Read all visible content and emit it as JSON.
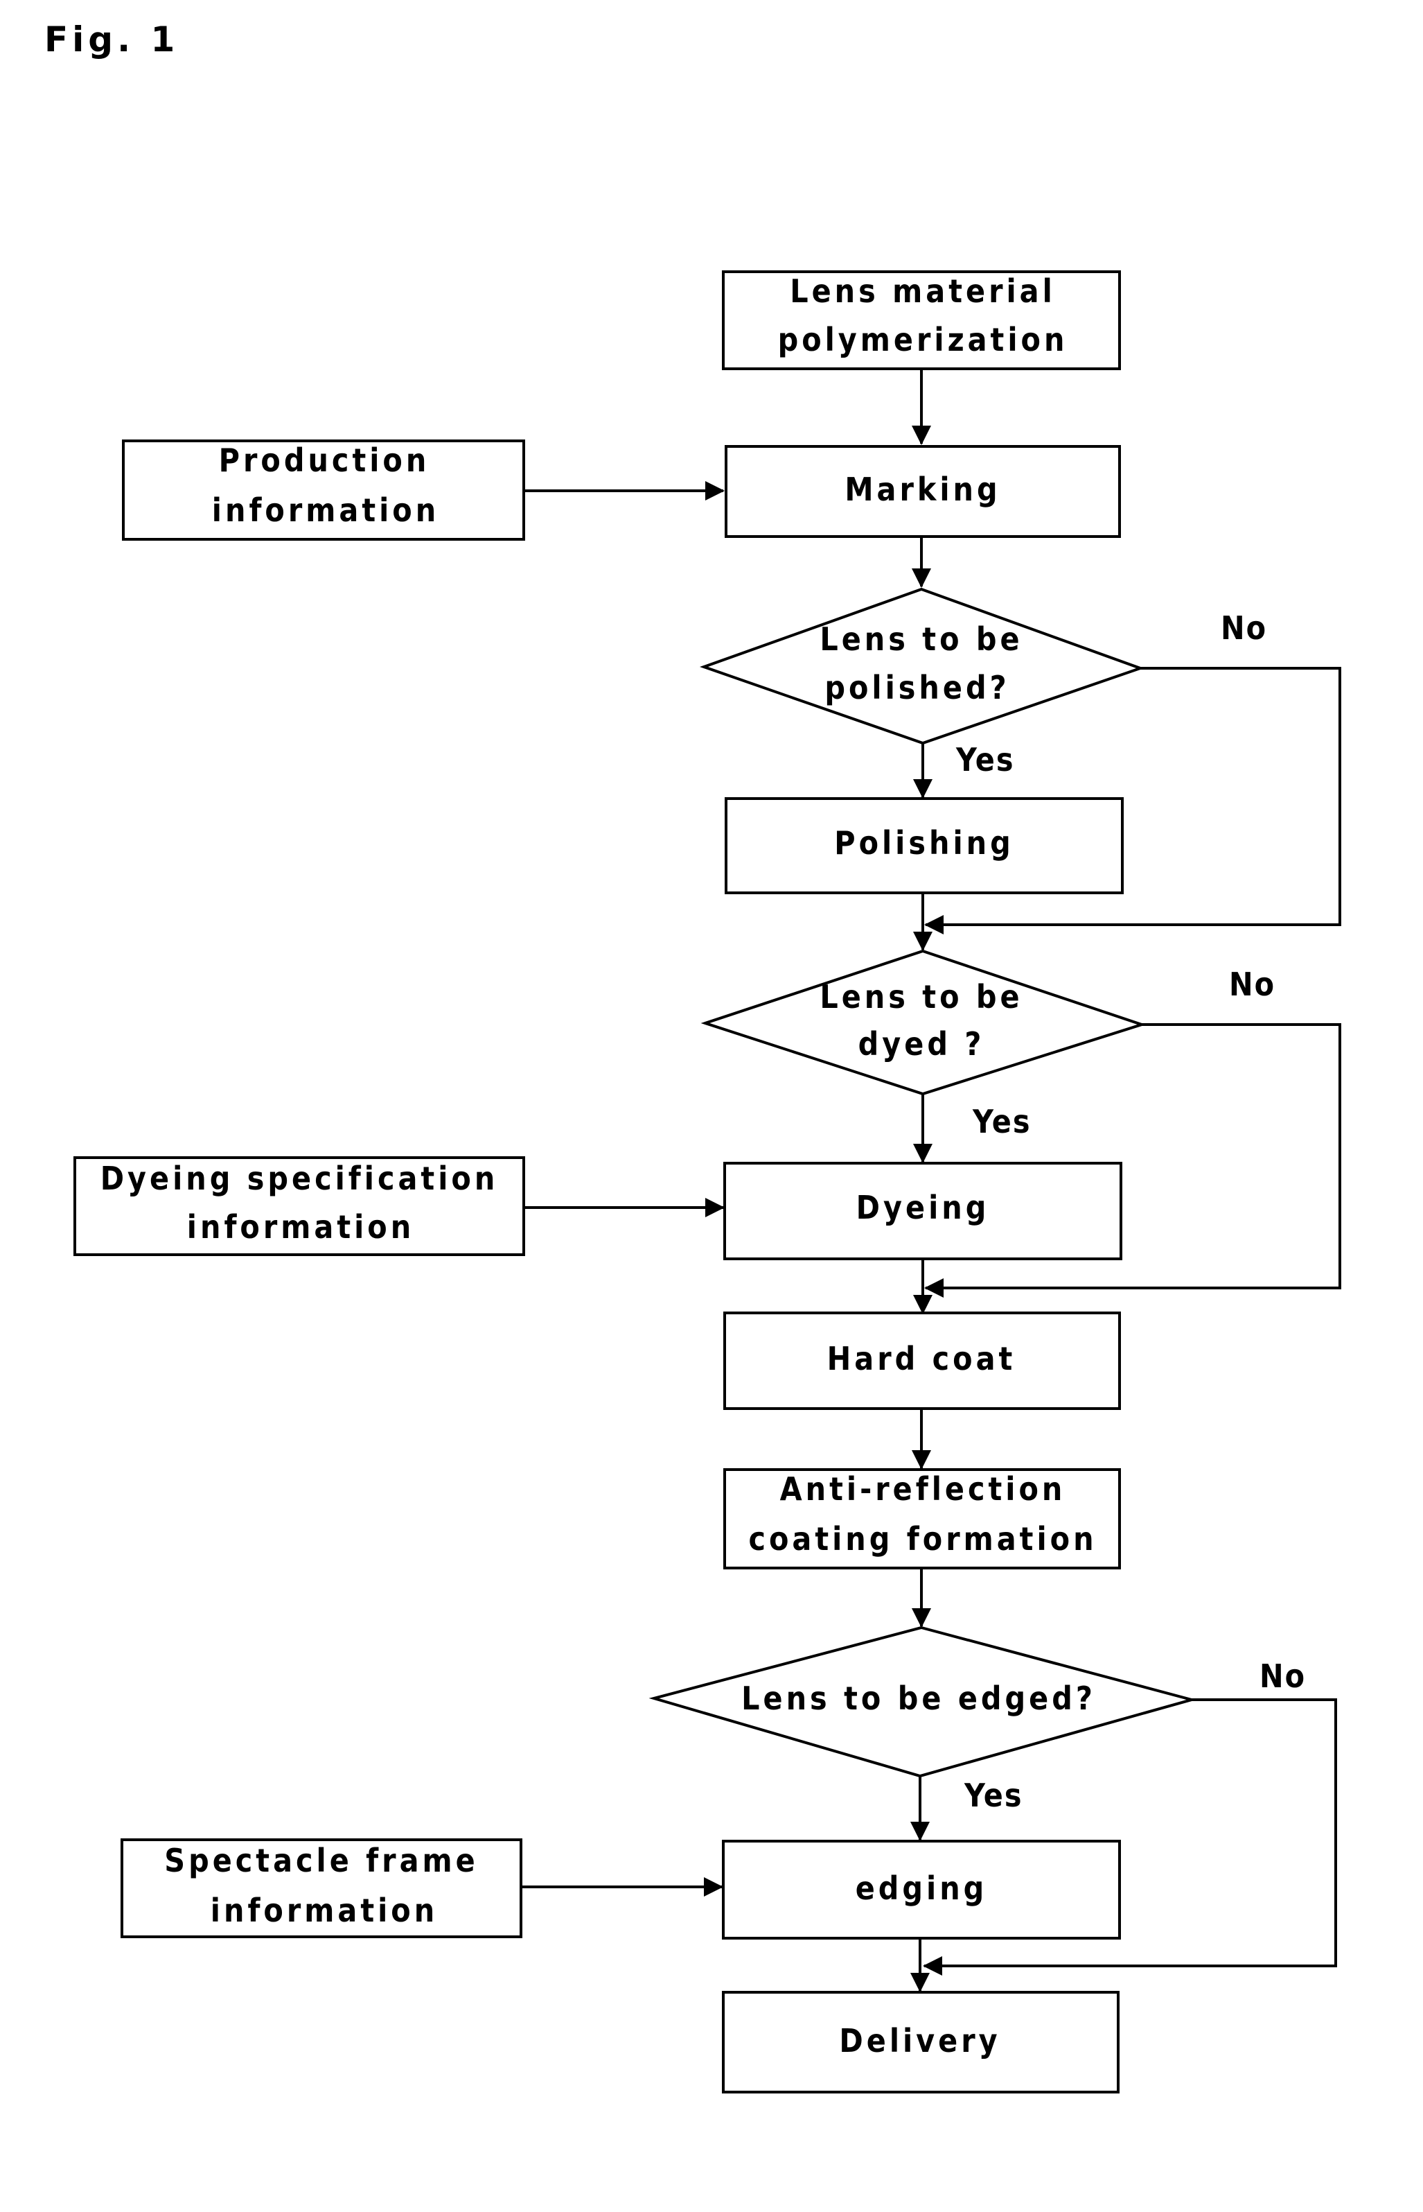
{
  "figure": {
    "label": "Fig. 1"
  },
  "colors": {
    "stroke": "#000000",
    "background": "#ffffff"
  },
  "nodes": {
    "polymerization": {
      "lines": [
        "Lens material",
        "polymerization"
      ]
    },
    "production_info": {
      "lines": [
        "Production",
        "information"
      ]
    },
    "marking": {
      "lines": [
        "Marking"
      ]
    },
    "decision_polish": {
      "lines": [
        "Lens to be",
        "polished?"
      ]
    },
    "polishing": {
      "lines": [
        "Polishing"
      ]
    },
    "decision_dye": {
      "lines": [
        "Lens to be",
        "dyed ?"
      ]
    },
    "dye_spec_info": {
      "lines": [
        "Dyeing specification",
        "information"
      ]
    },
    "dyeing": {
      "lines": [
        "Dyeing"
      ]
    },
    "hard_coat": {
      "lines": [
        "Hard coat"
      ]
    },
    "anti_reflection": {
      "lines": [
        "Anti-reflection",
        "coating formation"
      ]
    },
    "decision_edge": {
      "lines": [
        "Lens to be edged?"
      ]
    },
    "frame_info": {
      "lines": [
        "Spectacle frame",
        "information"
      ]
    },
    "edging": {
      "lines": [
        "edging"
      ]
    },
    "delivery": {
      "lines": [
        "Delivery"
      ]
    }
  },
  "branches": {
    "polish_yes": "Yes",
    "polish_no": "No",
    "dye_yes": "Yes",
    "dye_no": "No",
    "edge_yes": "Yes",
    "edge_no": "No"
  },
  "edges": [
    {
      "from": "polymerization",
      "to": "marking"
    },
    {
      "from": "production_info",
      "to": "marking"
    },
    {
      "from": "marking",
      "to": "decision_polish"
    },
    {
      "from": "decision_polish",
      "to": "polishing",
      "label": "Yes"
    },
    {
      "from": "decision_polish",
      "to": "decision_dye",
      "label": "No"
    },
    {
      "from": "polishing",
      "to": "decision_dye"
    },
    {
      "from": "decision_dye",
      "to": "dyeing",
      "label": "Yes"
    },
    {
      "from": "decision_dye",
      "to": "hard_coat",
      "label": "No"
    },
    {
      "from": "dye_spec_info",
      "to": "dyeing"
    },
    {
      "from": "dyeing",
      "to": "hard_coat"
    },
    {
      "from": "hard_coat",
      "to": "anti_reflection"
    },
    {
      "from": "anti_reflection",
      "to": "decision_edge"
    },
    {
      "from": "decision_edge",
      "to": "edging",
      "label": "Yes"
    },
    {
      "from": "decision_edge",
      "to": "delivery",
      "label": "No"
    },
    {
      "from": "frame_info",
      "to": "edging"
    },
    {
      "from": "edging",
      "to": "delivery"
    }
  ]
}
